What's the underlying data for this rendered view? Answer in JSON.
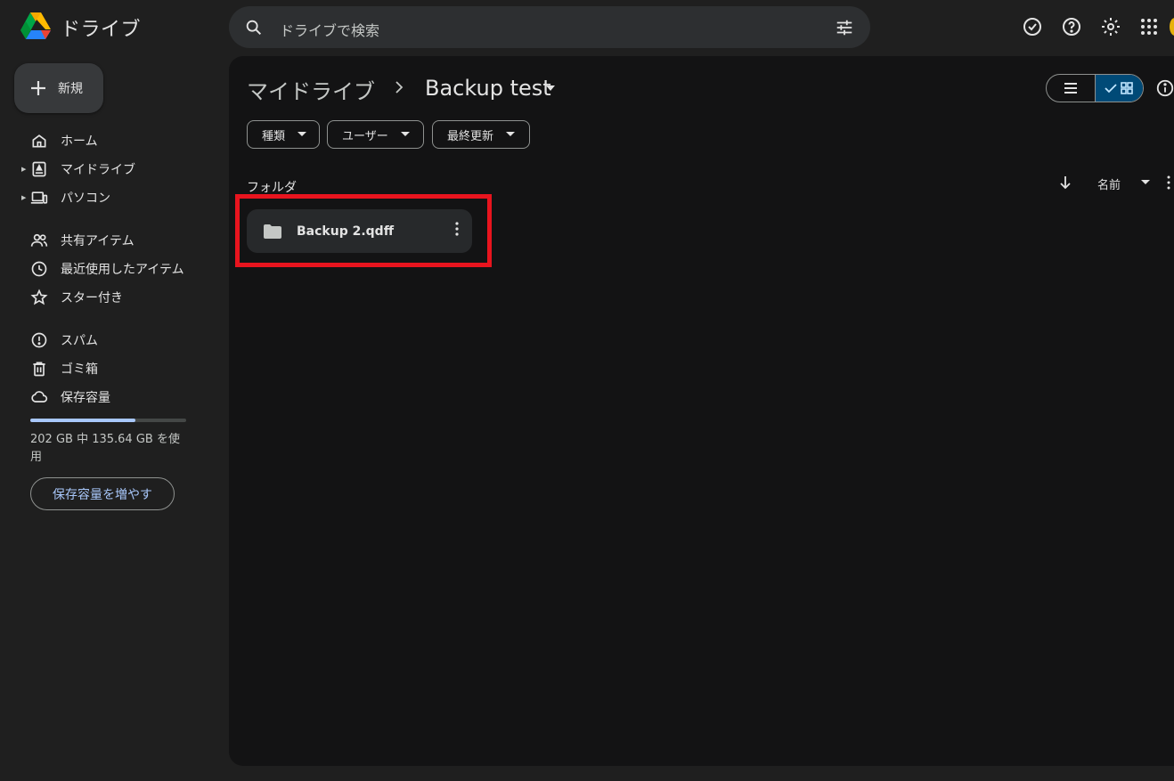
{
  "app": {
    "title": "ドライブ",
    "logo_icon": "google-drive-logo"
  },
  "search": {
    "placeholder": "ドライブで検索",
    "icon": "search-icon",
    "filter_icon": "tune-icon"
  },
  "header_icons": [
    "offline-ready-icon",
    "help-icon",
    "settings-icon",
    "apps-grid-icon"
  ],
  "sidebar": {
    "new_button_label": "新規",
    "items": [
      {
        "label": "ホーム",
        "icon": "home-icon"
      },
      {
        "label": "マイドライブ",
        "icon": "my-drive-icon",
        "expandable": true
      },
      {
        "label": "パソコン",
        "icon": "computers-icon",
        "expandable": true
      },
      {
        "label": "共有アイテム",
        "icon": "shared-icon"
      },
      {
        "label": "最近使用したアイテム",
        "icon": "clock-icon"
      },
      {
        "label": "スター付き",
        "icon": "star-icon"
      },
      {
        "label": "スパム",
        "icon": "spam-icon"
      },
      {
        "label": "ゴミ箱",
        "icon": "trash-icon"
      },
      {
        "label": "保存容量",
        "icon": "cloud-icon"
      }
    ],
    "storage": {
      "used_fraction": 0.6715,
      "text": "202 GB 中 135.64 GB を使用",
      "button_label": "保存容量を増やす"
    }
  },
  "breadcrumb": {
    "root": "マイドライブ",
    "current": "Backup test"
  },
  "filters": [
    "種類",
    "ユーザー",
    "最終更新"
  ],
  "section_label": "フォルダ",
  "sort": {
    "label": "名前",
    "direction": "descending"
  },
  "folders": [
    {
      "name": "Backup 2.qdff",
      "icon": "folder-icon"
    }
  ],
  "colors": {
    "background": "#1f1f1f",
    "panel": "#131314",
    "accent": "#a8c7fa",
    "highlight": "#e8141e"
  }
}
